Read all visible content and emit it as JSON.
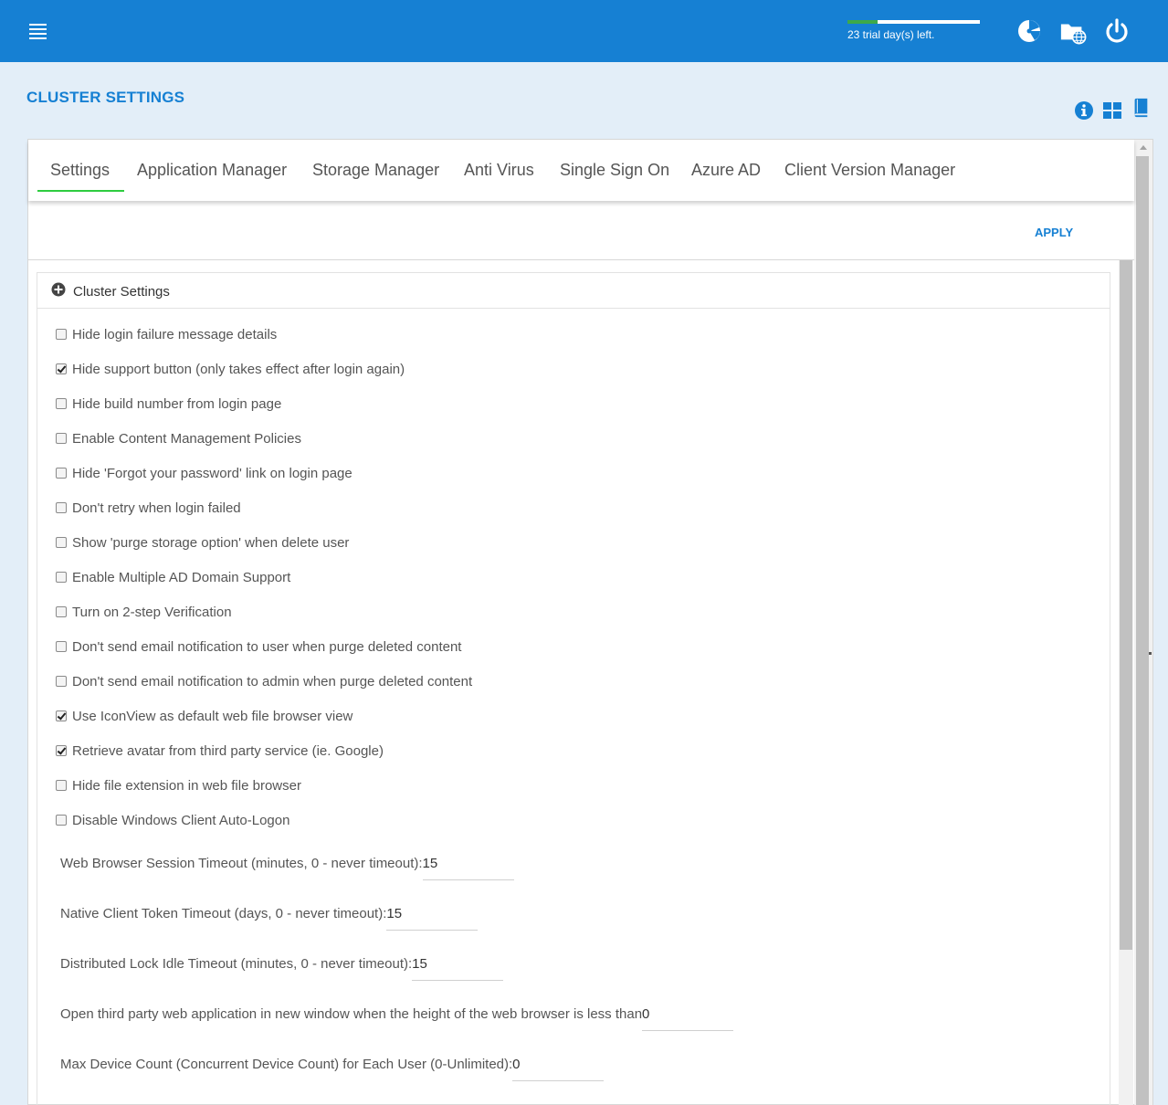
{
  "topbar": {
    "trial_text": "23 trial day(s) left.",
    "trial_progress": 0.23,
    "icons": [
      "menu-icon",
      "dashboard-icon",
      "web-folder-icon",
      "power-icon"
    ]
  },
  "page": {
    "title": "CLUSTER SETTINGS",
    "header_icons": [
      "info-icon",
      "grid-icon",
      "book-icon"
    ]
  },
  "tabs": [
    "Settings",
    "Application Manager",
    "Storage Manager",
    "Anti Virus",
    "Single Sign On",
    "Azure AD",
    "Client Version Manager"
  ],
  "active_tab": "Settings",
  "apply_label": "APPLY",
  "section": {
    "title": "Cluster Settings",
    "icon": "plus-circle-icon"
  },
  "options": [
    {
      "label": "Hide login failure message details",
      "checked": false
    },
    {
      "label": "Hide support button (only takes effect after login again)",
      "checked": true
    },
    {
      "label": "Hide build number from login page",
      "checked": false
    },
    {
      "label": "Enable Content Management Policies",
      "checked": false
    },
    {
      "label": "Hide 'Forgot your password' link on login page",
      "checked": false
    },
    {
      "label": "Don't retry when login failed",
      "checked": false
    },
    {
      "label": "Show 'purge storage option' when delete user",
      "checked": false
    },
    {
      "label": "Enable Multiple AD Domain Support",
      "checked": false
    },
    {
      "label": "Turn on 2-step Verification",
      "checked": false
    },
    {
      "label": "Don't send email notification to user when purge deleted content",
      "checked": false
    },
    {
      "label": "Don't send email notification to admin when purge deleted content",
      "checked": false
    },
    {
      "label": "Use IconView as default web file browser view",
      "checked": true
    },
    {
      "label": "Retrieve avatar from third party service (ie. Google)",
      "checked": true
    },
    {
      "label": "Hide file extension in web file browser",
      "checked": false
    },
    {
      "label": "Disable Windows Client Auto-Logon",
      "checked": false
    }
  ],
  "fields": [
    {
      "label": "Web Browser Session Timeout (minutes, 0 - never timeout):",
      "value": "15"
    },
    {
      "label": "Native Client Token Timeout (days, 0 - never timeout):",
      "value": "15"
    },
    {
      "label": "Distributed Lock Idle Timeout (minutes, 0 - never timeout):",
      "value": "15"
    },
    {
      "label": "Open third party web application in new window when the height of the web browser is less than",
      "value": "0"
    },
    {
      "label": "Max Device Count (Concurrent Device Count) for Each User (0-Unlimited):",
      "value": "0"
    }
  ],
  "colors": {
    "primary": "#1680d3",
    "accent_tab": "#2ecc40",
    "trial_fill": "#3da94a"
  }
}
